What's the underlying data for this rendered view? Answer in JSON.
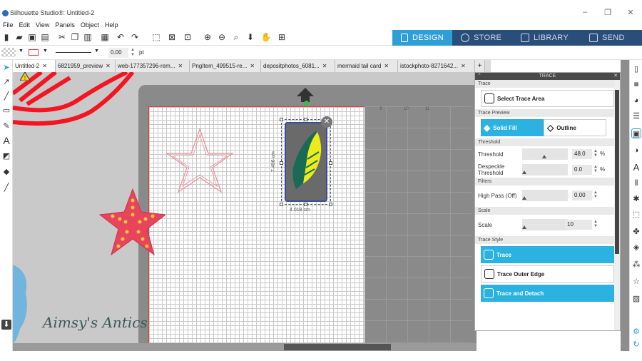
{
  "window": {
    "title": "Silhouette Studio®: Untitled-2"
  },
  "menu": [
    "File",
    "Edit",
    "View",
    "Panels",
    "Object",
    "Help"
  ],
  "nav_tabs": [
    {
      "label": "DESIGN",
      "active": true
    },
    {
      "label": "STORE",
      "active": false
    },
    {
      "label": "LIBRARY",
      "active": false
    },
    {
      "label": "SEND",
      "active": false
    }
  ],
  "props": {
    "line_width": "0.00",
    "line_unit": "pt"
  },
  "doc_tabs": [
    {
      "label": "Untitled-2",
      "active": true
    },
    {
      "label": "6821959_preview",
      "active": false
    },
    {
      "label": "web-177357296-rem...",
      "active": false
    },
    {
      "label": "PngItem_499515-re...",
      "active": false
    },
    {
      "label": "depositphotos_6081...",
      "active": false
    },
    {
      "label": "mermaid tail card",
      "active": false
    },
    {
      "label": "istockphoto-8271642...",
      "active": false
    }
  ],
  "selection": {
    "height_label": "7.496 cm",
    "width_label": "4.018 cm"
  },
  "watermark": "Aimsy's Antics",
  "ruler_numbers": [
    "9",
    "10",
    "11"
  ],
  "trace": {
    "panel_title": "TRACE",
    "section_trace": "Trace",
    "select_area": "Select Trace Area",
    "section_preview": "Trace Preview",
    "solid_fill": "Solid Fill",
    "outline": "Outline",
    "section_threshold": "Threshold",
    "threshold_label": "Threshold",
    "threshold_value": "48.0",
    "threshold_unit": "%",
    "despeckle_label_1": "Despeckle",
    "despeckle_label_2": "Threshold",
    "despeckle_value": "0.0",
    "despeckle_unit": "%",
    "section_filters": "Filters",
    "highpass_label": "High Pass (Off)",
    "highpass_value": "0.00",
    "section_scale": "Scale",
    "scale_label": "Scale",
    "scale_value": "10",
    "section_style": "Trace Style",
    "style_trace": "Trace",
    "style_outer": "Trace Outer Edge",
    "style_detach": "Trace and Detach"
  },
  "colors": {
    "accent": "#2bb2e0",
    "nav_bg": "#2a4e7a",
    "starfish": "#e8455c"
  }
}
